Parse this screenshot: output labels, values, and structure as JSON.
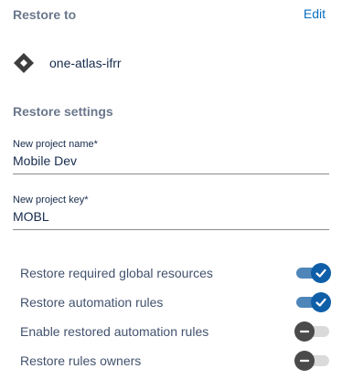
{
  "restore_to": {
    "title": "Restore to",
    "edit_label": "Edit",
    "site_icon": "diamond-icon",
    "site_name": "one-atlas-ifrr"
  },
  "restore_settings": {
    "title": "Restore settings",
    "project_name_label": "New project name*",
    "project_name_value": "Mobile Dev",
    "project_key_label": "New project key*",
    "project_key_value": "MOBL"
  },
  "toggles": [
    {
      "label": "Restore required global resources",
      "checked": true,
      "icon": "check-icon"
    },
    {
      "label": "Restore automation rules",
      "checked": true,
      "icon": "check-icon"
    },
    {
      "label": "Enable restored automation rules",
      "checked": false,
      "icon": "minus-icon"
    },
    {
      "label": "Restore rules owners",
      "checked": false,
      "icon": "minus-icon"
    }
  ],
  "colors": {
    "accent": "#0f5ea8",
    "link": "#0a6fc2",
    "muted_heading": "#6b778c"
  }
}
